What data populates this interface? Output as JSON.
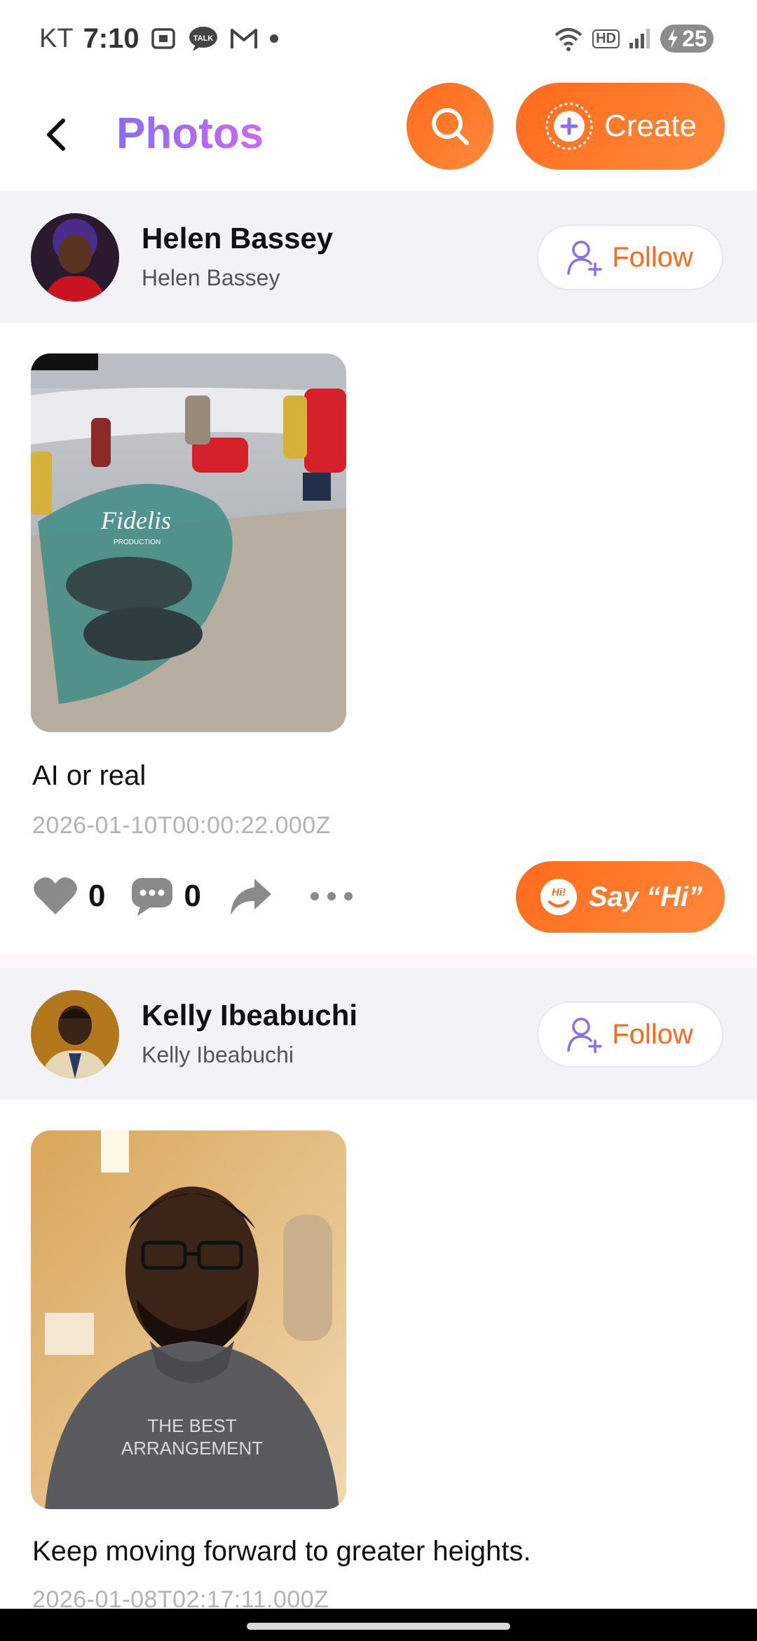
{
  "status_bar": {
    "carrier": "KT",
    "time": "7:10",
    "talk_badge": "TALK",
    "battery": "25"
  },
  "header": {
    "title": "Photos",
    "create_label": "Create"
  },
  "posts": [
    {
      "user_name": "Helen Bassey",
      "user_sub": "Helen Bassey",
      "follow_label": "Follow",
      "photo_watermark": "Fidelis",
      "photo_watermark_sub": "PRODUCTION",
      "caption": "AI or real",
      "timestamp": "2026-01-10T00:00:22.000Z",
      "likes": "0",
      "comments": "0",
      "say_hi_label": "Say “Hi”",
      "say_hi_badge": "Hi!"
    },
    {
      "user_name": "Kelly Ibeabuchi",
      "user_sub": "Kelly Ibeabuchi",
      "follow_label": "Follow",
      "photo_shirt_text_1": "THE BEST",
      "photo_shirt_text_2": "ARRANGEMENT",
      "caption": "Keep moving forward to greater heights.",
      "timestamp": "2026-01-08T02:17:11.000Z"
    }
  ],
  "colors": {
    "accent_orange": "#ff6a1a",
    "title_gradient_start": "#8a6cf5",
    "title_gradient_end": "#c86bf0",
    "follow_icon": "#8a6cf5"
  }
}
